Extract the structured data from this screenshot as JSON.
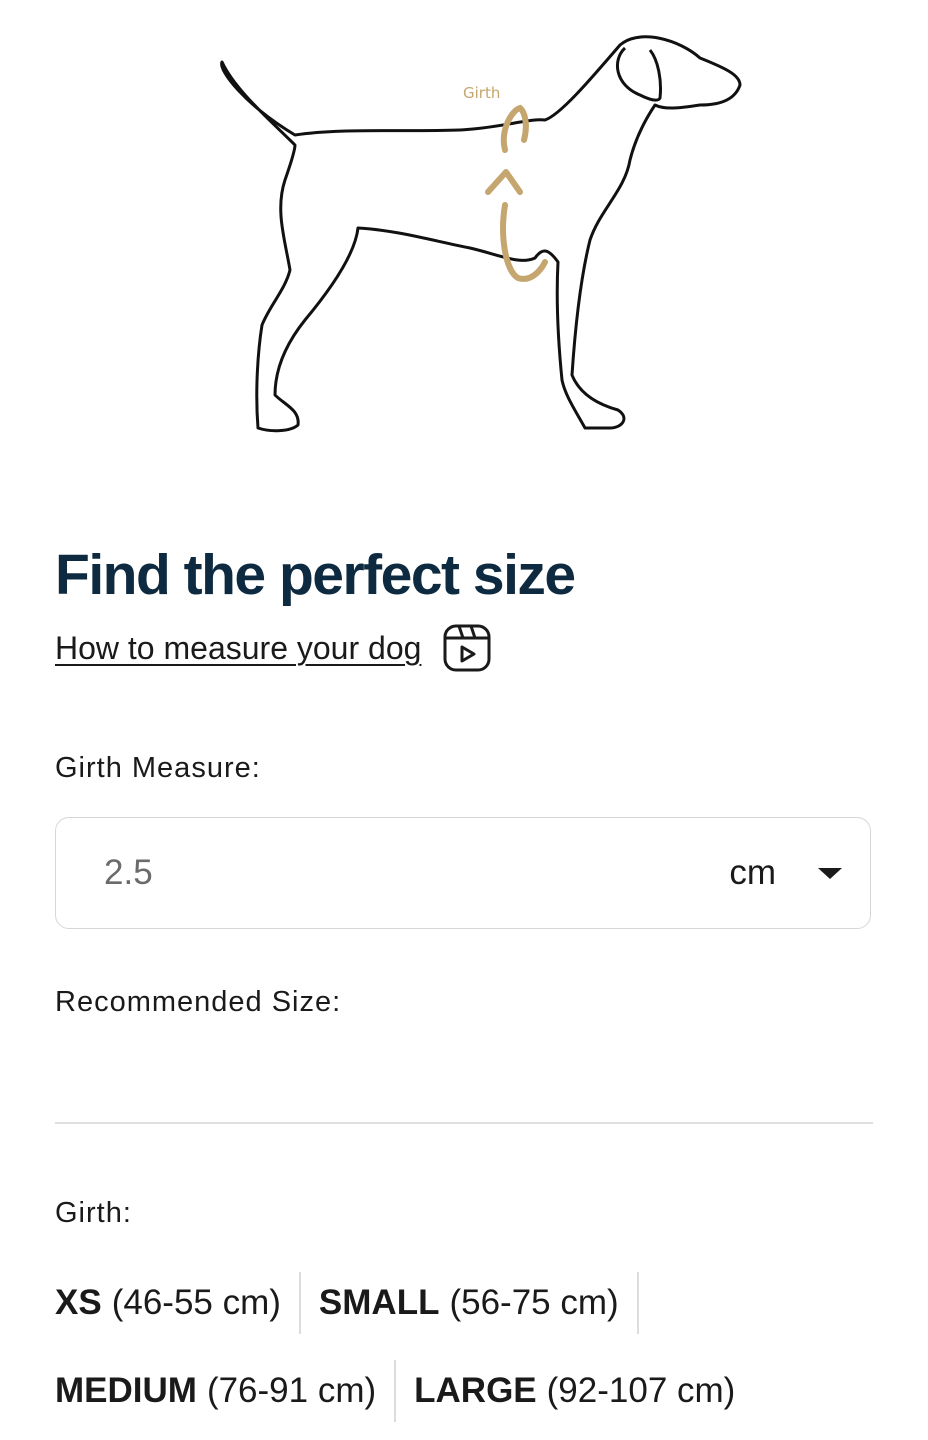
{
  "illustration": {
    "girth_label": "Girth",
    "accent_color": "#c4a66e"
  },
  "title": "Find the perfect size",
  "howto": {
    "link_text": "How to measure your dog",
    "icon": "video-play-icon"
  },
  "girth_measure": {
    "label": "Girth Measure:",
    "value": "2.5",
    "unit": "cm"
  },
  "recommended": {
    "label": "Recommended Size:",
    "value": ""
  },
  "girth_sizes": {
    "label": "Girth:",
    "sizes": [
      {
        "name": "XS",
        "range": "(46-55 cm)"
      },
      {
        "name": "SMALL",
        "range": "(56-75 cm)"
      },
      {
        "name": "MEDIUM",
        "range": "(76-91 cm)"
      },
      {
        "name": "LARGE",
        "range": "(92-107 cm)"
      }
    ]
  },
  "colors": {
    "title": "#0d2a40",
    "text": "#1a1a1a",
    "accent": "#c4a66e",
    "border": "#d6d6d6"
  }
}
